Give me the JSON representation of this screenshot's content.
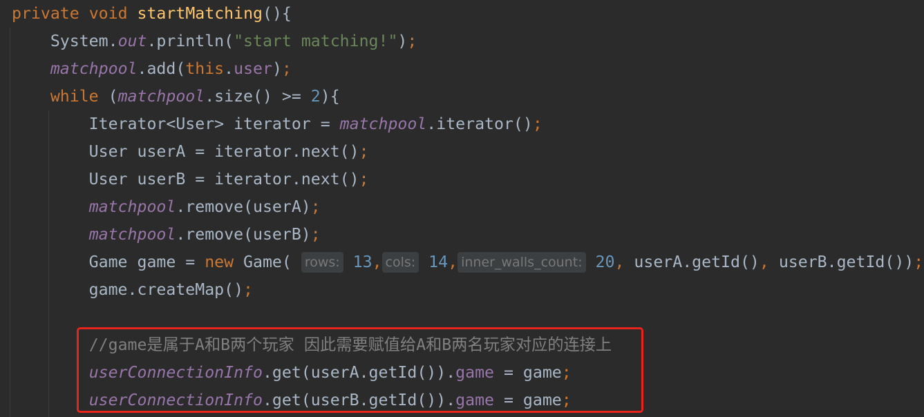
{
  "editor": {
    "lines": [
      {
        "tokens": [
          {
            "t": "private",
            "c": "kw"
          },
          {
            "t": " "
          },
          {
            "t": "void",
            "c": "kw"
          },
          {
            "t": " "
          },
          {
            "t": "startMatching",
            "c": "fn"
          },
          {
            "t": "(){"
          }
        ]
      },
      {
        "tokens": [
          {
            "t": "    System."
          },
          {
            "t": "out",
            "c": "sfld"
          },
          {
            "t": ".println("
          },
          {
            "t": "\"start matching!\"",
            "c": "str"
          },
          {
            "t": ")"
          },
          {
            "t": ";",
            "c": "punct"
          }
        ]
      },
      {
        "tokens": [
          {
            "t": "    "
          },
          {
            "t": "matchpool",
            "c": "sfld"
          },
          {
            "t": ".add("
          },
          {
            "t": "this",
            "c": "kw"
          },
          {
            "t": "."
          },
          {
            "t": "user",
            "c": "fld"
          },
          {
            "t": ")"
          },
          {
            "t": ";",
            "c": "punct"
          }
        ]
      },
      {
        "tokens": [
          {
            "t": "    "
          },
          {
            "t": "while",
            "c": "kw"
          },
          {
            "t": " ("
          },
          {
            "t": "matchpool",
            "c": "sfld"
          },
          {
            "t": ".size() >= "
          },
          {
            "t": "2",
            "c": "num"
          },
          {
            "t": "){"
          }
        ]
      },
      {
        "tokens": [
          {
            "t": "        Iterator<User> iterator = "
          },
          {
            "t": "matchpool",
            "c": "sfld"
          },
          {
            "t": ".iterator()"
          },
          {
            "t": ";",
            "c": "punct"
          }
        ]
      },
      {
        "tokens": [
          {
            "t": "        User userA = iterator.next()"
          },
          {
            "t": ";",
            "c": "punct"
          }
        ]
      },
      {
        "tokens": [
          {
            "t": "        User userB = iterator.next()"
          },
          {
            "t": ";",
            "c": "punct"
          }
        ]
      },
      {
        "tokens": [
          {
            "t": "        "
          },
          {
            "t": "matchpool",
            "c": "sfld"
          },
          {
            "t": ".remove(userA)"
          },
          {
            "t": ";",
            "c": "punct"
          }
        ]
      },
      {
        "tokens": [
          {
            "t": "        "
          },
          {
            "t": "matchpool",
            "c": "sfld"
          },
          {
            "t": ".remove(userB)"
          },
          {
            "t": ";",
            "c": "punct"
          }
        ]
      },
      {
        "tokens": [
          {
            "t": "        Game game = "
          },
          {
            "t": "new",
            "c": "kw"
          },
          {
            "t": " Game( "
          },
          {
            "t": "rows:",
            "c": "hint"
          },
          {
            "t": " "
          },
          {
            "t": "13",
            "c": "num"
          },
          {
            "t": ",",
            "c": "punct"
          },
          {
            "t": "cols:",
            "c": "hint"
          },
          {
            "t": " "
          },
          {
            "t": "14",
            "c": "num"
          },
          {
            "t": ",",
            "c": "punct"
          },
          {
            "t": "inner_walls_count:",
            "c": "hint"
          },
          {
            "t": " "
          },
          {
            "t": "20",
            "c": "num"
          },
          {
            "t": ",",
            "c": "punct"
          },
          {
            "t": " userA.getId()"
          },
          {
            "t": ",",
            "c": "punct"
          },
          {
            "t": " userB.getId())"
          },
          {
            "t": ";",
            "c": "punct"
          }
        ]
      },
      {
        "tokens": [
          {
            "t": "        game.createMap()"
          },
          {
            "t": ";",
            "c": "punct"
          }
        ]
      },
      {
        "tokens": [
          {
            "t": ""
          }
        ]
      },
      {
        "tokens": [
          {
            "t": "        "
          },
          {
            "t": "//game是属于A和B两个玩家 因此需要赋值给A和B两名玩家对应的连接上",
            "c": "cmt"
          }
        ]
      },
      {
        "tokens": [
          {
            "t": "        "
          },
          {
            "t": "userConnectionInfo",
            "c": "sfld"
          },
          {
            "t": ".get(userA.getId())."
          },
          {
            "t": "game",
            "c": "fld"
          },
          {
            "t": " = game"
          },
          {
            "t": ";",
            "c": "punct"
          }
        ]
      },
      {
        "tokens": [
          {
            "t": "        "
          },
          {
            "t": "userConnectionInfo",
            "c": "sfld"
          },
          {
            "t": ".get(userB.getId())."
          },
          {
            "t": "game",
            "c": "fld"
          },
          {
            "t": " = game"
          },
          {
            "t": ";",
            "c": "punct"
          }
        ]
      }
    ],
    "colors": {
      "background": "#2b2b2b",
      "keyword": "#cc7832",
      "method": "#ffc66d",
      "string": "#6a8759",
      "number": "#6897bb",
      "field": "#9876aa",
      "comment": "#808080",
      "highlight_border": "#e8231c"
    }
  }
}
